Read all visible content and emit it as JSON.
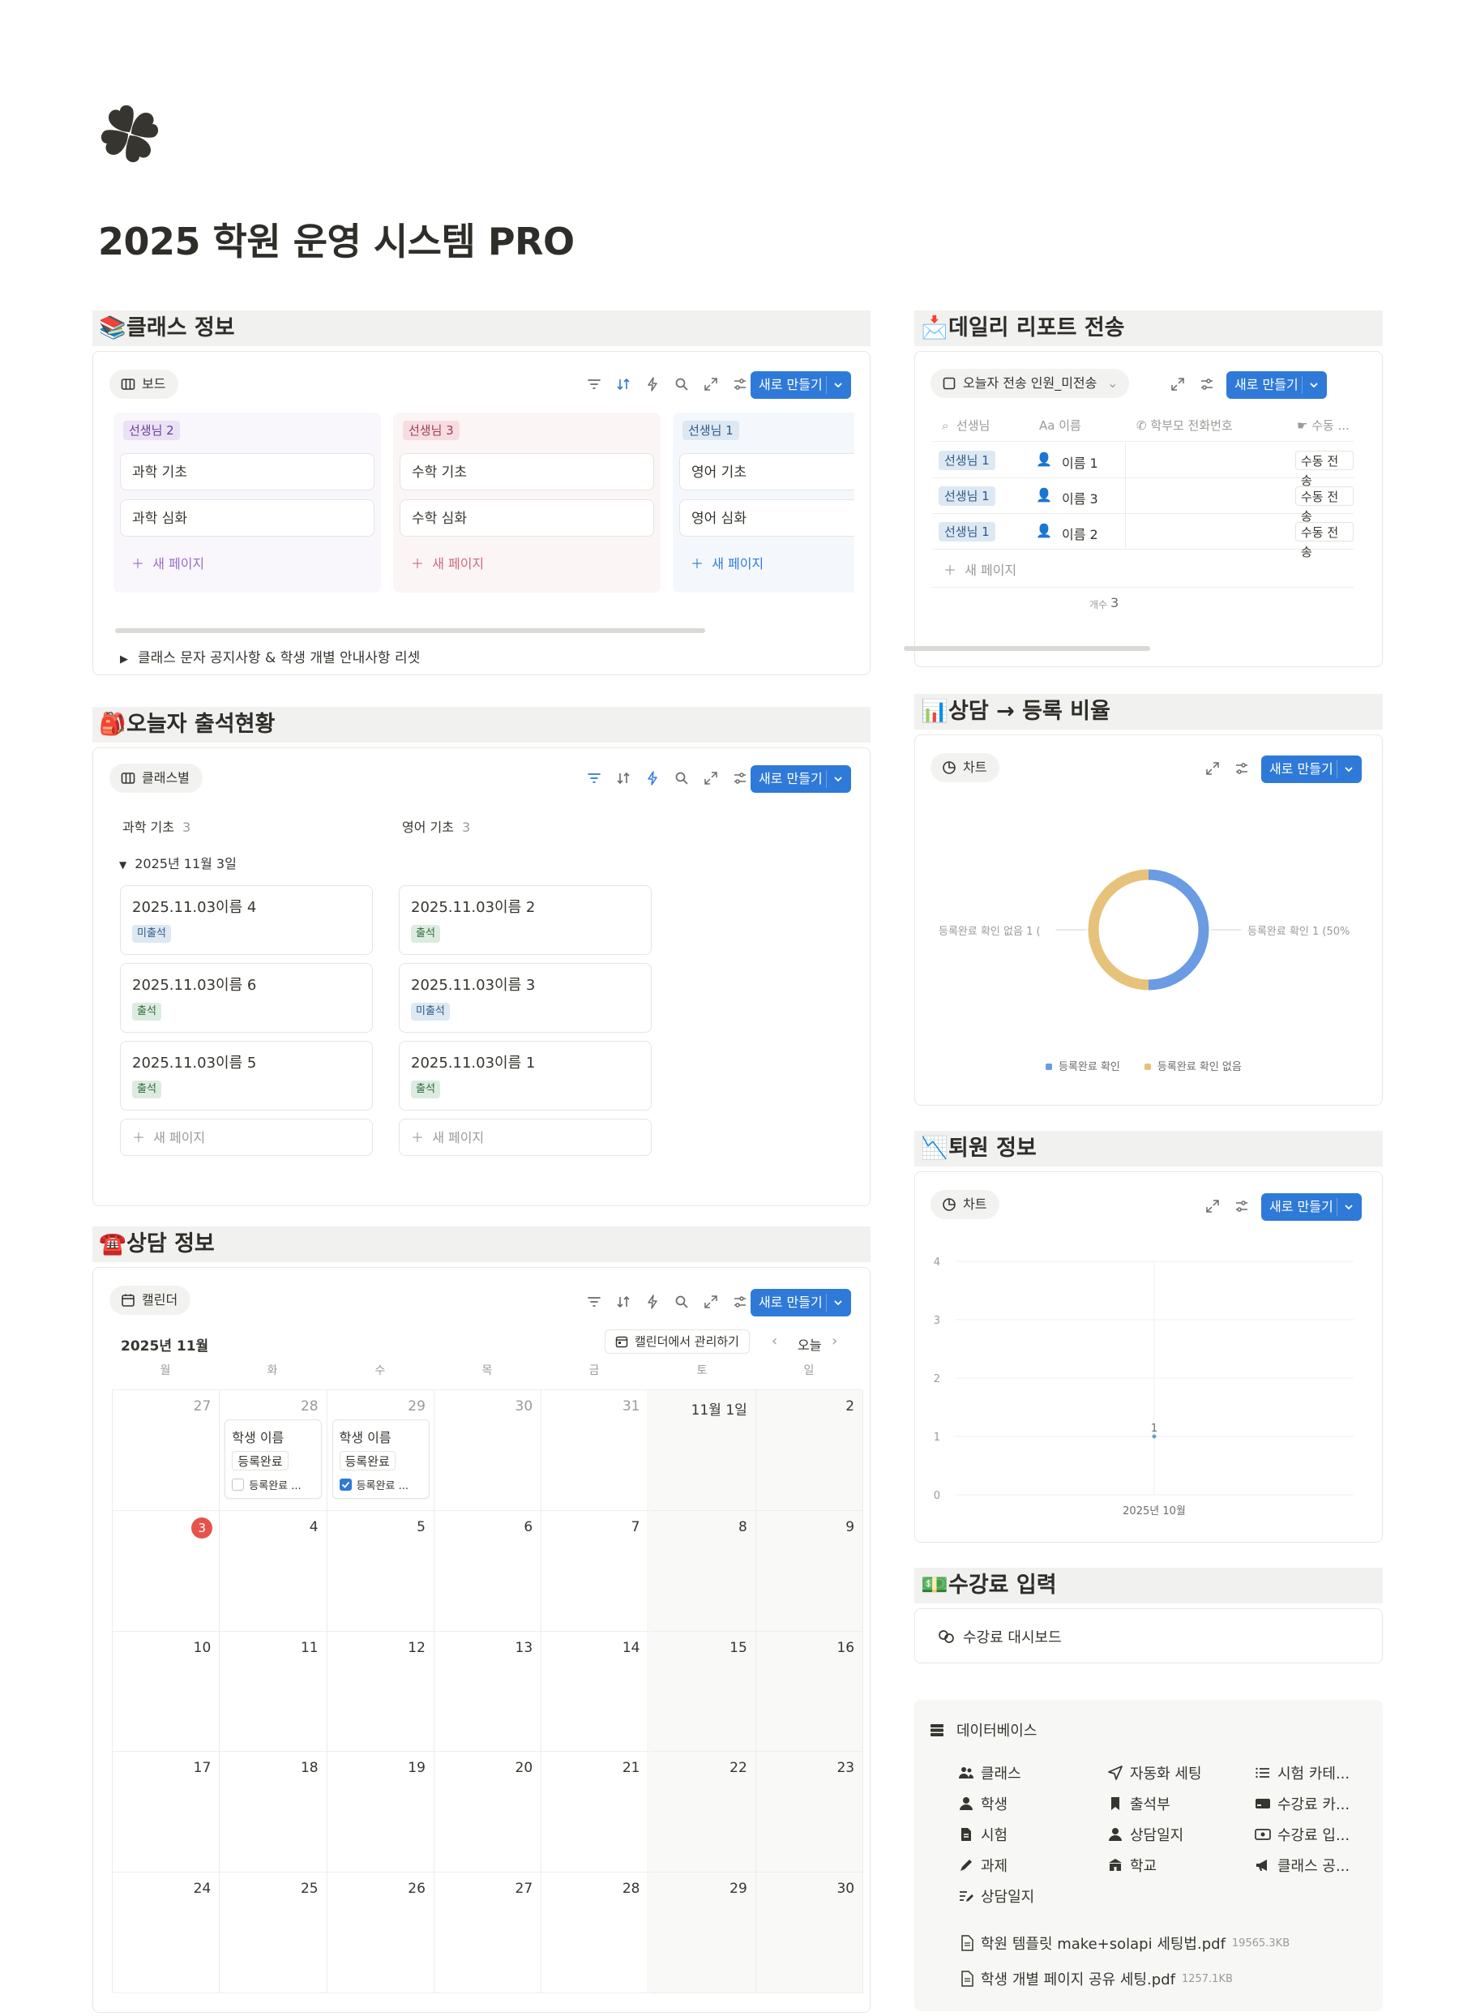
{
  "page": {
    "title": "2025 학원 운영 시스템 PRO"
  },
  "toolbar": {
    "new_label": "새로 만들기",
    "new_page": "새 페이지"
  },
  "class_info": {
    "header": "클래스 정보",
    "view": "보드",
    "columns": [
      {
        "label": "선생님 2",
        "cards": [
          "과학 기초",
          "과학 심화"
        ]
      },
      {
        "label": "선생님 3",
        "cards": [
          "수학 기초",
          "수학 심화"
        ]
      },
      {
        "label": "선생님 1",
        "cards": [
          "영어 기초",
          "영어 심화"
        ]
      }
    ],
    "toggle": "클래스 문자 공지사항 & 학생 개별 안내사항 리셋"
  },
  "attendance": {
    "header": "오늘자 출석현황",
    "view": "클래스별",
    "groups": [
      {
        "name": "과학 기초",
        "count": "3"
      },
      {
        "name": "영어 기초",
        "count": "3"
      }
    ],
    "subgroup": "2025년 11월 3일",
    "cards_left": [
      {
        "name": "2025.11.03이름 4",
        "tag": "미출석"
      },
      {
        "name": "2025.11.03이름 6",
        "tag": "출석"
      },
      {
        "name": "2025.11.03이름 5",
        "tag": "출석"
      }
    ],
    "cards_right": [
      {
        "name": "2025.11.03이름 2",
        "tag": "출석"
      },
      {
        "name": "2025.11.03이름 3",
        "tag": "미출석"
      },
      {
        "name": "2025.11.03이름 1",
        "tag": "출석"
      }
    ]
  },
  "consult": {
    "header": "상담 정보",
    "view": "캘린더",
    "month": "2025년 11월",
    "manage": "캘린더에서 관리하기",
    "today": "오늘",
    "weekdays": [
      "월",
      "화",
      "수",
      "목",
      "금",
      "토",
      "일"
    ],
    "weeks": [
      [
        "27",
        "28",
        "29",
        "30",
        "31",
        "11월 1일",
        "2"
      ],
      [
        "3",
        "4",
        "5",
        "6",
        "7",
        "8",
        "9"
      ],
      [
        "10",
        "11",
        "12",
        "13",
        "14",
        "15",
        "16"
      ],
      [
        "17",
        "18",
        "19",
        "20",
        "21",
        "22",
        "23"
      ],
      [
        "24",
        "25",
        "26",
        "27",
        "28",
        "29",
        "30"
      ]
    ],
    "events": [
      {
        "name": "학생 이름",
        "status": "등록완료",
        "check": "등록완료 ...",
        "checked": false
      },
      {
        "name": "학생 이름",
        "status": "등록완료",
        "check": "등록완료 ...",
        "checked": true
      }
    ]
  },
  "daily_report": {
    "header": "데일리 리포트 전송",
    "view": "오늘자 전송 인원_미전송",
    "columns": [
      "선생님",
      "이름",
      "학부모 전화번호",
      "수동 ..."
    ],
    "rows": [
      {
        "teacher": "선생님 1",
        "name": "이름 1",
        "action": "수동 전송"
      },
      {
        "teacher": "선생님 1",
        "name": "이름 3",
        "action": "수동 전송"
      },
      {
        "teacher": "선생님 1",
        "name": "이름 2",
        "action": "수동 전송"
      }
    ],
    "count_label": "개수",
    "count": "3"
  },
  "ratio": {
    "header": "상담 → 등록 비율",
    "view": "차트",
    "left_label": "등록완료 확인 없음 1 (",
    "right_label": "등록완료 확인 1 (50%",
    "legend": [
      "등록완료 확인",
      "등록완료 확인 없음"
    ]
  },
  "withdraw": {
    "header": "퇴원 정보",
    "view": "차트",
    "yticks": [
      "4",
      "3",
      "2",
      "1",
      "0"
    ],
    "xlabel": "2025년 10월",
    "point_label": "1"
  },
  "chart_data": [
    {
      "type": "pie",
      "categories": [
        "등록완료 확인",
        "등록완료 확인 없음"
      ],
      "values": [
        1,
        1
      ],
      "colors": [
        "#6a9be3",
        "#e6c27a"
      ],
      "legend": "bottom"
    },
    {
      "type": "line",
      "x": [
        "2025년 10월"
      ],
      "series": [
        {
          "values": [
            1
          ]
        }
      ],
      "ylim": [
        0,
        4
      ],
      "grid": true
    }
  ],
  "tuition": {
    "header": "수강료 입력",
    "link": "수강료 대시보드"
  },
  "database": {
    "title": "데이터베이스",
    "col1": [
      "클래스",
      "학생",
      "시험",
      "과제",
      "상담일지"
    ],
    "col2": [
      "자동화 세팅",
      "출석부",
      "상담일지",
      "학교"
    ],
    "col3": [
      "시험 카테...",
      "수강료 카...",
      "수강료 입...",
      "클래스 공..."
    ],
    "files": [
      {
        "name": "학원 템플릿 make+solapi 세팅법.pdf",
        "size": "19565.3KB"
      },
      {
        "name": "학생 개별 페이지 공유 세팅.pdf",
        "size": "1257.1KB"
      }
    ]
  },
  "colors": {
    "accent": "#2f7ad8",
    "sec_bg": "#f1f1ef",
    "purple_col": "#f9f6fc",
    "pink_col": "#fcf5f6",
    "blue_col": "#f4f8fc"
  }
}
